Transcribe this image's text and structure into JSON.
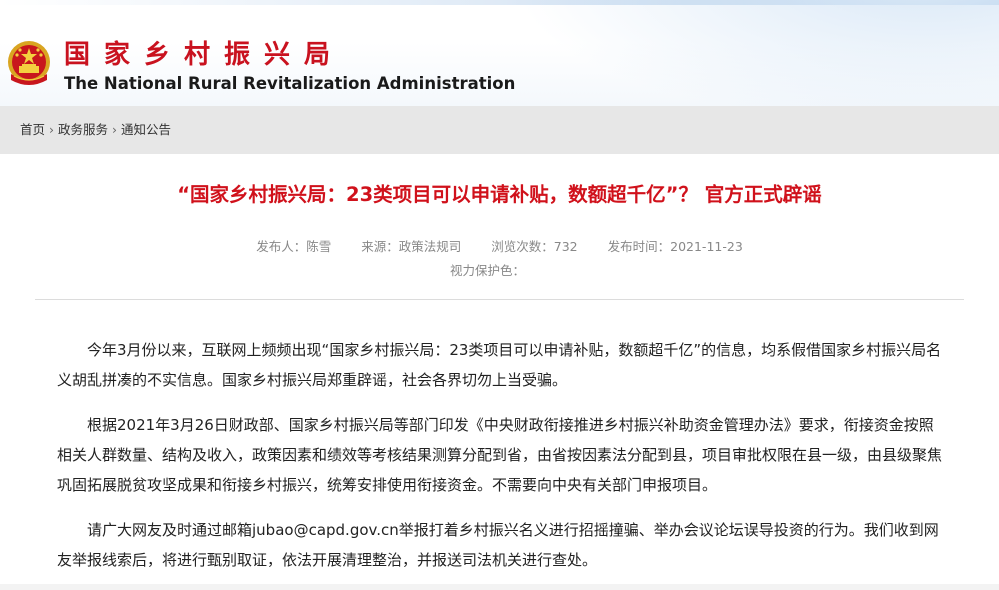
{
  "header": {
    "title_cn": "国家乡村振兴局",
    "title_en": "The National Rural Revitalization Administration",
    "emblem_icon": "national-emblem-icon"
  },
  "breadcrumb": {
    "items": [
      "首页",
      "政务服务",
      "通知公告"
    ],
    "separator": "›"
  },
  "article": {
    "title": "“国家乡村振兴局：23类项目可以申请补贴，数额超千亿”？ 官方正式辟谣",
    "meta": {
      "publisher_label": "发布人：",
      "publisher": "陈雪",
      "source_label": "来源：",
      "source": "政策法规司",
      "views_label": "浏览次数：",
      "views": "732",
      "date_label": "发布时间：",
      "date": "2021-11-23",
      "eye_color_label": "视力保护色："
    },
    "paragraphs": [
      "今年3月份以来，互联网上频频出现“国家乡村振兴局：23类项目可以申请补贴，数额超千亿”的信息，均系假借国家乡村振兴局名义胡乱拼凑的不实信息。国家乡村振兴局郑重辟谣，社会各界切勿上当受骗。",
      "根据2021年3月26日财政部、国家乡村振兴局等部门印发《中央财政衔接推进乡村振兴补助资金管理办法》要求，衔接资金按照相关人群数量、结构及收入，政策因素和绩效等考核结果测算分配到省，由省按因素法分配到县，项目审批权限在县一级，由县级聚焦巩固拓展脱贫攻坚成果和衔接乡村振兴，统筹安排使用衔接资金。不需要向中央有关部门申报项目。",
      "请广大网友及时通过邮箱jubao@capd.gov.cn举报打着乡村振兴名义进行招摇撞骗、举办会议论坛误导投资的行为。我们收到网友举报线索后，将进行甄别取证，依法开展清理整治，并报送司法机关进行查处。"
    ]
  },
  "colors": {
    "brand_red": "#c9121f",
    "title_red": "#d0111b",
    "meta_gray": "#888888"
  }
}
